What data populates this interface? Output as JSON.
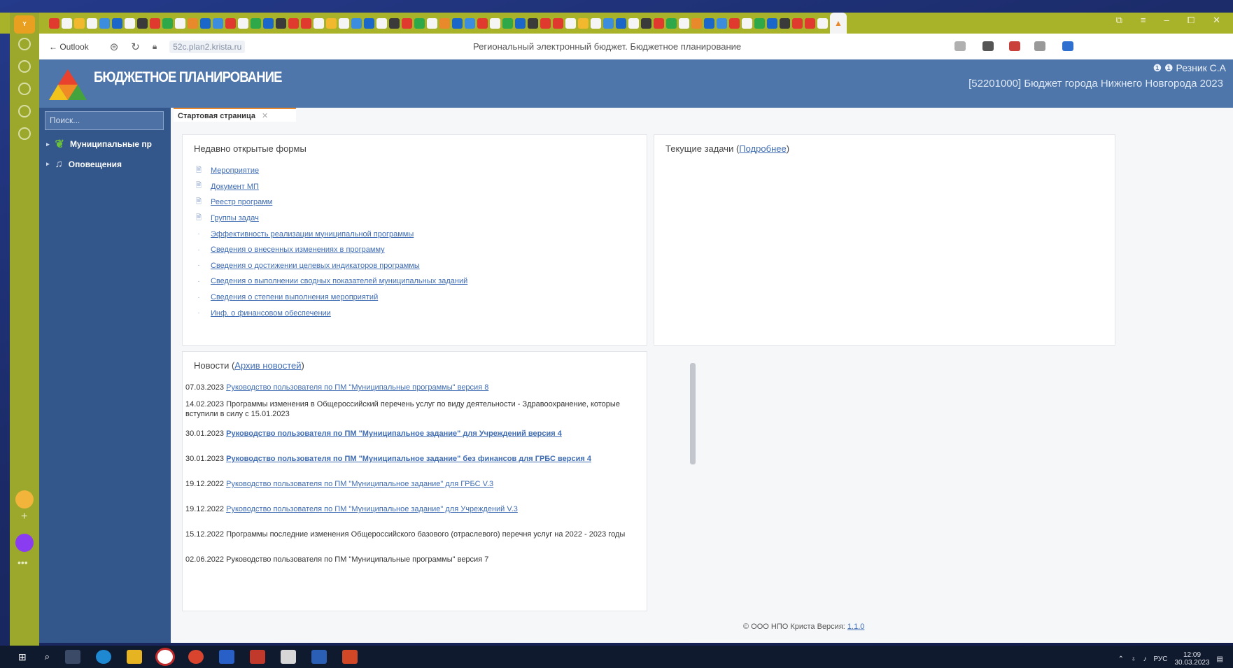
{
  "browser": {
    "back_label": "← Outlook",
    "url": "52c.plan2.krista.ru",
    "page_title": "Региональный электронный бюджет. Бюджетное планирование",
    "window_controls": [
      "⧉",
      "≡",
      "–",
      "⧠",
      "✕"
    ]
  },
  "app": {
    "name": "БЮДЖЕТНОЕ ПЛАНИРОВАНИЕ",
    "user": "Резник С.А",
    "budget": "[52201000] Бюджет города Нижнего Новгорода 2023"
  },
  "sidebar": {
    "search_placeholder": "Поиск...",
    "items": [
      {
        "label": "Муниципальные пр",
        "icon": "leaf-icon"
      },
      {
        "label": "Оповещения",
        "icon": "bell-icon"
      }
    ]
  },
  "tab": {
    "label": "Стартовая страница",
    "close": "✕"
  },
  "recent": {
    "title": "Недавно открытые формы",
    "items": [
      "Мероприятие",
      "Документ МП",
      "Реестр программ",
      "Группы задач",
      "Эффективность реализации муниципальной программы",
      "Сведения о внесенных изменениях в программу",
      "Сведения о достижении целевых индикаторов программы",
      "Сведения о выполнении сводных показателей муниципальных заданий",
      "Сведения о степени выполнения мероприятий",
      "Инф. о финансовом обеспечении"
    ]
  },
  "tasks": {
    "title": "Текущие задачи",
    "link": "Подробнее"
  },
  "news": {
    "title": "Новости",
    "archive_link": "Архив новостей",
    "items": [
      {
        "date": "07.03.2023",
        "text": "Руководство пользователя по ПМ \"Муниципальные программы\" версия 8",
        "link": true,
        "bold": false
      },
      {
        "date": "14.02.2023",
        "text": "Программы изменения в Общероссийский перечень услуг по виду деятельности - Здравоохранение, которые вступили в силу с 15.01.2023",
        "link": false,
        "bold": false
      },
      {
        "date": "30.01.2023",
        "text": "Руководство пользователя по ПМ \"Муниципальное задание\" для Учреждений версия 4",
        "link": true,
        "bold": true
      },
      {
        "date": "30.01.2023",
        "text": "Руководство пользователя по ПМ \"Муниципальное задание\" без финансов для ГРБС версия 4",
        "link": true,
        "bold": true
      },
      {
        "date": "19.12.2022",
        "text": "Руководство пользователя по ПМ \"Муниципальное задание\" для ГРБС V.3",
        "link": true,
        "bold": false
      },
      {
        "date": "19.12.2022",
        "text": "Руководство пользователя по ПМ \"Муниципальное задание\" для Учреждений V.3",
        "link": true,
        "bold": false
      },
      {
        "date": "15.12.2022",
        "text": "Программы последние изменения Общероссийского базового (отраслевого) перечня услуг на 2022 - 2023 годы",
        "link": false,
        "bold": false
      },
      {
        "date": "02.06.2022",
        "text": "Руководство пользователя по ПМ \"Муниципальные программы\" версия 7",
        "link": false,
        "bold": false
      }
    ]
  },
  "footer": {
    "text": "© ООО НПО Криста Версия:",
    "version": "1.1.0"
  },
  "taskbar": {
    "tray_lang": "РУС",
    "time": "12:09",
    "date": "30.03.2023"
  },
  "colors": {
    "header": "#4e76aa",
    "sidebar": "#34578b",
    "link": "#3f6cb3",
    "tab_accent": "#e88a2c",
    "browser_chrome": "#a9b32a"
  }
}
